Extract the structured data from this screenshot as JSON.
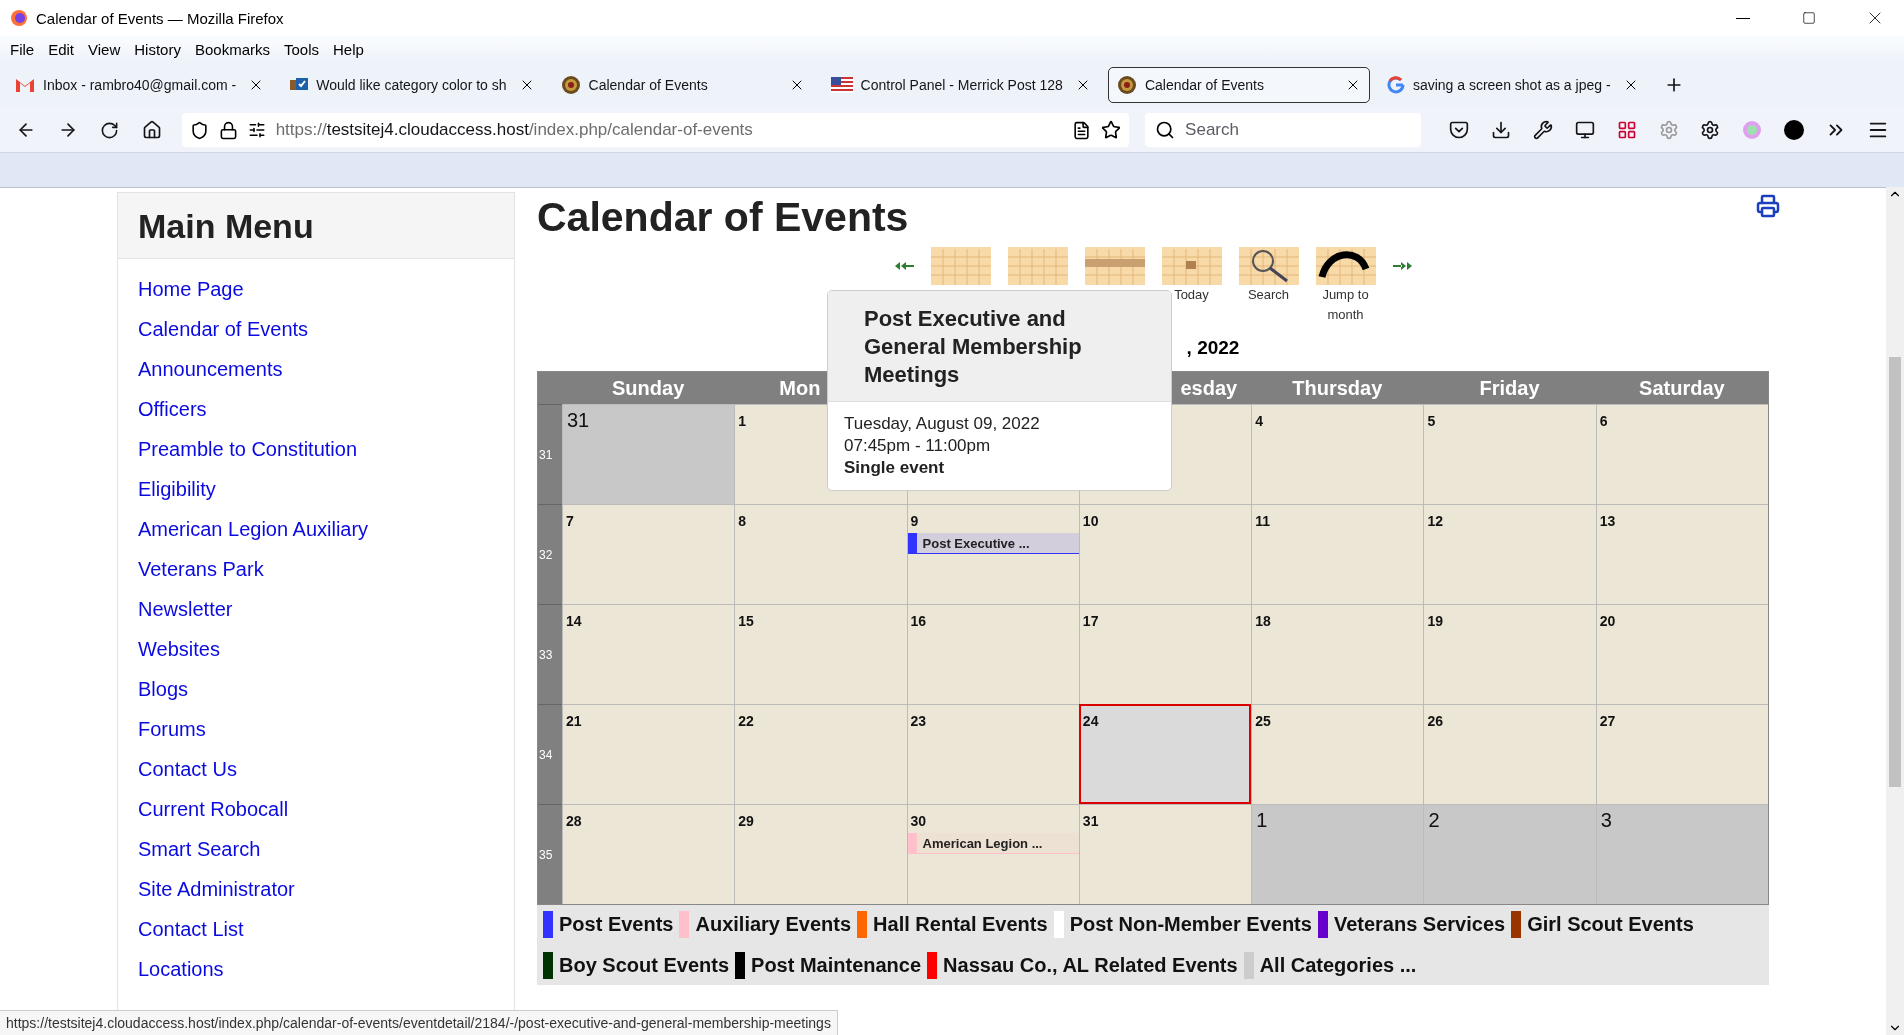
{
  "window": {
    "title": "Calendar of Events — Mozilla Firefox"
  },
  "menu_bar": [
    "File",
    "Edit",
    "View",
    "History",
    "Bookmarks",
    "Tools",
    "Help"
  ],
  "tabs": [
    {
      "title": "Inbox - rambro40@gmail.com -",
      "selected": false
    },
    {
      "title": "Would like category color to sh",
      "selected": false
    },
    {
      "title": "Calendar of Events",
      "selected": false
    },
    {
      "title": "Control Panel - Merrick Post 128",
      "selected": false
    },
    {
      "title": "Calendar of Events",
      "selected": true
    },
    {
      "title": "saving a screen shot as a jpeg -",
      "selected": false
    }
  ],
  "address_bar": {
    "scheme": "https://",
    "host": "testsitej4.cloudaccess.host",
    "path": "/index.php/calendar-of-events"
  },
  "search": {
    "placeholder": "Search"
  },
  "sidebar": {
    "title": "Main Menu",
    "items": [
      "Home Page",
      "Calendar of Events",
      "Announcements",
      "Officers",
      "Preamble to Constitution",
      "Eligibility",
      "American Legion Auxiliary",
      "Veterans Park",
      "Newsletter",
      "Websites",
      "Blogs",
      "Forums",
      "Contact Us",
      "Current Robocall",
      "Smart Search",
      "Site Administrator",
      "Contact List",
      "Locations"
    ]
  },
  "page_title": "Calendar of Events",
  "calendar_nav": [
    {
      "kind": "year"
    },
    {
      "kind": "month"
    },
    {
      "kind": "week"
    },
    {
      "kind": "today",
      "label": "Today"
    },
    {
      "kind": "search",
      "label": "Search"
    },
    {
      "kind": "jump",
      "label": "Jump to month"
    }
  ],
  "month_title": ", 2022",
  "weekdays": [
    {
      "label": "Sunday"
    },
    {
      "label": "Mon",
      "kind": "cut_right"
    },
    {
      "label": "esday",
      "kind": "cut_left"
    },
    {
      "label": "Thursday"
    },
    {
      "label": "Friday"
    },
    {
      "label": "Saturday"
    }
  ],
  "weeks": [
    {
      "number": "31",
      "days": [
        {
          "day": "31",
          "kind": "other"
        },
        {
          "day": "1",
          "kind": "current"
        },
        {
          "kind": "current"
        },
        {
          "kind": "current"
        },
        {
          "day": "4",
          "kind": "current"
        },
        {
          "day": "5",
          "kind": "current"
        },
        {
          "day": "6",
          "kind": "current"
        }
      ]
    },
    {
      "number": "32",
      "days": [
        {
          "day": "7",
          "kind": "current"
        },
        {
          "day": "8",
          "kind": "current"
        },
        {
          "day": "9",
          "kind": "current",
          "events": [
            {
              "title": "Post Executive ...",
              "color": "#3333ff"
            }
          ]
        },
        {
          "day": "10",
          "kind": "current"
        },
        {
          "day": "11",
          "kind": "current"
        },
        {
          "day": "12",
          "kind": "current"
        },
        {
          "day": "13",
          "kind": "current"
        }
      ]
    },
    {
      "number": "33",
      "days": [
        {
          "day": "14",
          "kind": "current"
        },
        {
          "day": "15",
          "kind": "current"
        },
        {
          "day": "16",
          "kind": "current"
        },
        {
          "day": "17",
          "kind": "current"
        },
        {
          "day": "18",
          "kind": "current"
        },
        {
          "day": "19",
          "kind": "current"
        },
        {
          "day": "20",
          "kind": "current"
        }
      ]
    },
    {
      "number": "34",
      "days": [
        {
          "day": "21",
          "kind": "current"
        },
        {
          "day": "22",
          "kind": "current"
        },
        {
          "day": "23",
          "kind": "current"
        },
        {
          "day": "24",
          "kind": "today"
        },
        {
          "day": "25",
          "kind": "current"
        },
        {
          "day": "26",
          "kind": "current"
        },
        {
          "day": "27",
          "kind": "current"
        }
      ]
    },
    {
      "number": "35",
      "days": [
        {
          "day": "28",
          "kind": "current"
        },
        {
          "day": "29",
          "kind": "current"
        },
        {
          "day": "30",
          "kind": "current",
          "events": [
            {
              "title": "American Legion ...",
              "color": "#ffc0cb"
            }
          ]
        },
        {
          "day": "31",
          "kind": "current"
        },
        {
          "day": "1",
          "kind": "other"
        },
        {
          "day": "2",
          "kind": "other"
        },
        {
          "day": "3",
          "kind": "other"
        }
      ]
    }
  ],
  "legend": [
    {
      "label": "Post Events",
      "color": "#3333ff"
    },
    {
      "label": "Auxiliary Events",
      "color": "#ffc0cb"
    },
    {
      "label": "Hall Rental Events",
      "color": "#ff6600"
    },
    {
      "label": "Post Non-Member Events",
      "color": "#ffffff"
    },
    {
      "label": "Veterans Services",
      "color": "#6600cc"
    },
    {
      "label": "Girl Scout Events",
      "color": "#993300"
    },
    {
      "label": "Boy Scout Events",
      "color": "#003300"
    },
    {
      "label": "Post Maintenance",
      "color": "#000000"
    },
    {
      "label": "Nassau Co., AL Related Events",
      "color": "#ff0000"
    },
    {
      "label": "All Categories ...",
      "color": "#cccccc"
    }
  ],
  "tooltip": {
    "title": "Post Executive and General Membership Meetings",
    "date": "Tuesday, August 09, 2022",
    "time": "07:45pm - 11:00pm",
    "recurrence": "Single event"
  },
  "status_bar": "https://testsitej4.cloudaccess.host/index.php/calendar-of-events/eventdetail/2184/-/post-executive-and-general-membership-meetings"
}
